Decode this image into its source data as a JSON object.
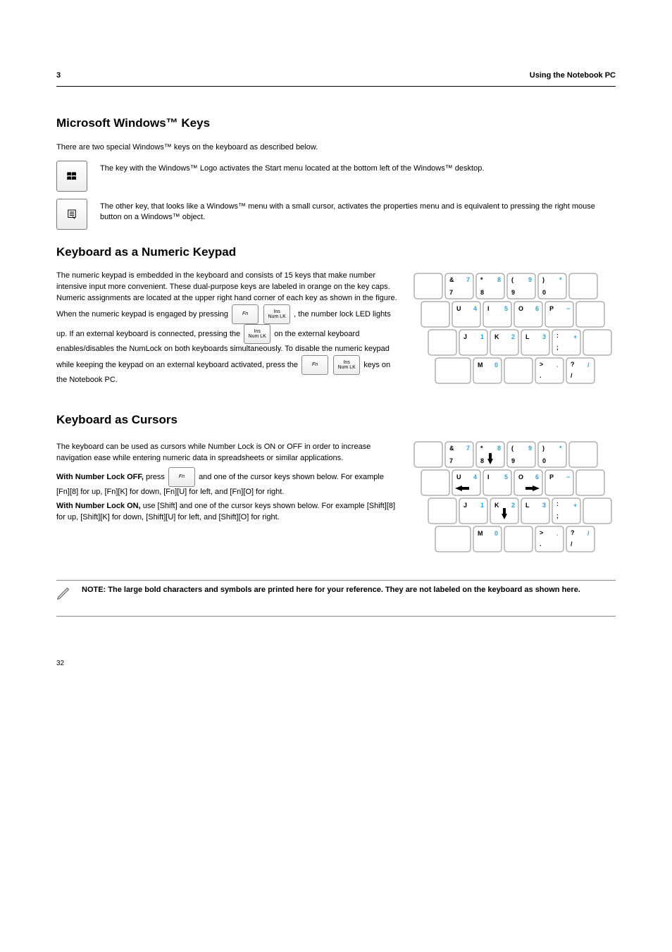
{
  "header": {
    "chapter_num": "3",
    "chapter_title": "Using the Notebook PC"
  },
  "winkeys": {
    "section_title": "Microsoft Windows™ Keys",
    "intro": "There are two special Windows™ keys on the keyboard as described below.",
    "win_key_desc": "The key with the Windows™ Logo activates the Start menu located at the bottom left of the Windows™ desktop.",
    "app_key_desc": "The other key, that looks like a Windows™ menu with a small cursor, activates the properties menu and is equivalent to pressing the right mouse button on a Windows™ object."
  },
  "numpad": {
    "section_title": "Keyboard as a Numeric Keypad",
    "para1_a": "The numeric keypad is embedded in the keyboard and consists of 15 keys that make number intensive input more convenient. These dual-purpose keys are labeled in orange on the key caps. Numeric assignments are located at the upper right hand corner of each key as shown in the figure. When the numeric keypad is engaged by pressing ",
    "para1_b": ", the number lock LED lights up. If an external keyboard is connected, pressing the ",
    "para1_c": " on the external keyboard enables/disables the NumLock on both keyboards simultaneously. To disable the numeric keypad while keeping the keypad on an external keyboard activated, press the ",
    "para1_d": " keys on the Notebook PC."
  },
  "cursors": {
    "section_title": "Keyboard as Cursors",
    "para1_a": "The keyboard can be used as cursors while Number Lock is ON or OFF in order to increase navigation ease while entering numeric data in spreadsheets or similar applications.",
    "on_a": "With Number Lock OFF,",
    "on_b": " press ",
    "on_c": " and one of the cursor keys shown below. For example [Fn][8] for up, [Fn][K] for down, [Fn][U] for left, and [Fn][O] for right.",
    "off_a": "With Number Lock ON,",
    "off_b": " use [Shift] and one of the cursor keys shown below. For example [Shift][8] for up, [Shift][K] for down, [Shift][U] for left, and [Shift][O] for right."
  },
  "keys_small": {
    "fn": "Fn",
    "ins": "Ins",
    "numlk": "Num LK"
  },
  "note": "NOTE: The large bold characters and symbols are printed here for your reference. They are not labeled on the keyboard as shown here.",
  "pad": {
    "amp": "&",
    "seven": "7",
    "sevenB": "7",
    "star": "*",
    "eight": "8",
    "eightB": "8",
    "lp": "(",
    "nine": "9",
    "nineB": "9",
    "rp": ")",
    "zero": "0",
    "starB": "*",
    "u": "U",
    "four": "4",
    "i": "I",
    "five": "5",
    "o": "O",
    "six": "6",
    "p": "P",
    "minus": "−",
    "j": "J",
    "one": "1",
    "k": "K",
    "two": "2",
    "l": "L",
    "three": "3",
    "colon": ":",
    "semi": ";",
    "plus": "+",
    "m": "M",
    "zero2": "0",
    "gt": ">",
    "dot": ".",
    "dot2": ".",
    "q": "?",
    "slash": "/",
    "slash2": "/"
  },
  "footer": {
    "page": "32"
  }
}
